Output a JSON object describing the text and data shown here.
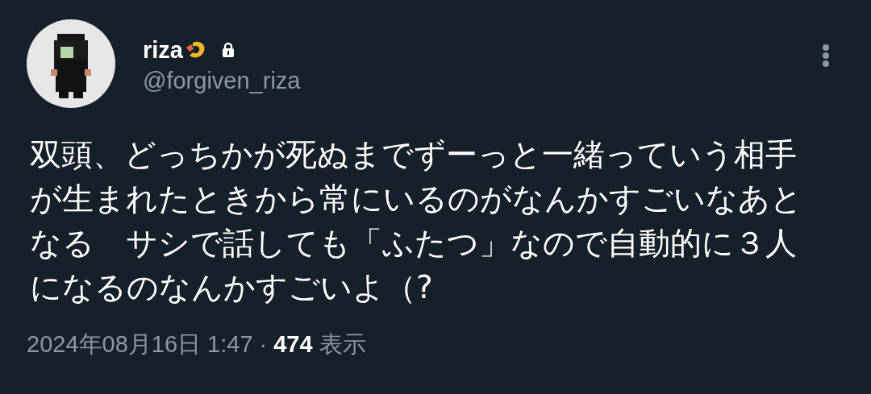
{
  "author": {
    "name": "riza",
    "handle": "@forgiven_riza",
    "protected": true
  },
  "text": "双頭、どっちかが死ぬまでずーっと一緒っていう相手が生まれたときから常にいるのがなんかすごいなあとなる　サシで話しても「ふたつ」なので自動的に３人になるのなんかすごいよ（?",
  "footer": {
    "timestamp": "2024年08月16日 1:47",
    "separator": "·",
    "views": "474",
    "views_label": "表示"
  }
}
